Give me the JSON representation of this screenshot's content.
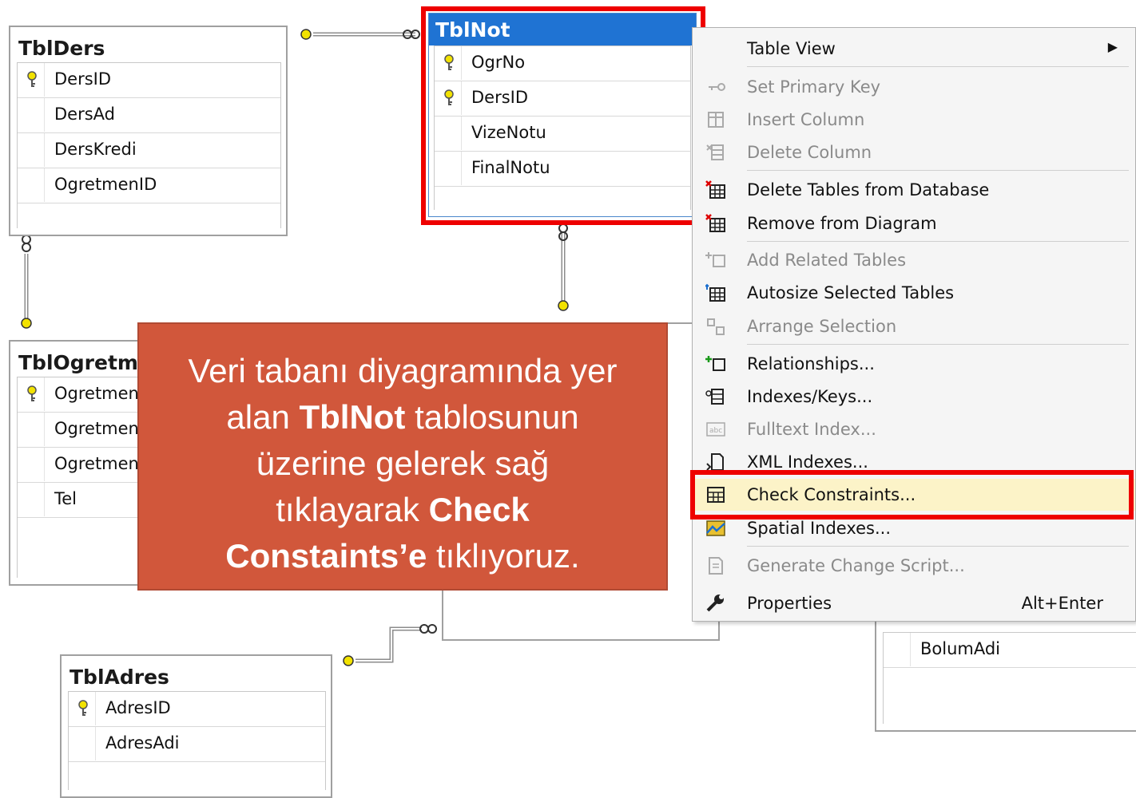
{
  "tables": {
    "tblders": {
      "title": "TblDers",
      "columns": [
        {
          "name": "DersID",
          "key": true
        },
        {
          "name": "DersAd"
        },
        {
          "name": "DersKredi"
        },
        {
          "name": "OgretmenID"
        }
      ]
    },
    "tblnot": {
      "title": "TblNot",
      "columns": [
        {
          "name": "OgrNo",
          "key": true
        },
        {
          "name": "DersID",
          "key": true
        },
        {
          "name": "VizeNotu"
        },
        {
          "name": "FinalNotu"
        }
      ]
    },
    "tblogretmen": {
      "title": "TblOgretmen",
      "columns": [
        {
          "name": "OgretmenID",
          "key": true
        },
        {
          "name": "OgretmenAd"
        },
        {
          "name": "OgretmenSoyad"
        },
        {
          "name": "Tel"
        }
      ]
    },
    "tbladres": {
      "title": "TblAdres",
      "columns": [
        {
          "name": "AdresID",
          "key": true
        },
        {
          "name": "AdresAdi"
        }
      ]
    },
    "tblbolum": {
      "columns": [
        {
          "name": "BolumAdi"
        }
      ]
    }
  },
  "context_menu": {
    "items": [
      {
        "label": "Table View",
        "enabled": true,
        "submenu": true,
        "icon": "none"
      },
      {
        "label": "Set Primary Key",
        "enabled": false,
        "icon": "key-icon"
      },
      {
        "label": "Insert Column",
        "enabled": false,
        "icon": "insert-column-icon"
      },
      {
        "label": "Delete Column",
        "enabled": false,
        "icon": "delete-column-icon"
      },
      {
        "label": "Delete Tables from Database",
        "enabled": true,
        "icon": "delete-table-icon"
      },
      {
        "label": "Remove from Diagram",
        "enabled": true,
        "icon": "remove-table-icon"
      },
      {
        "label": "Add Related Tables",
        "enabled": false,
        "icon": "add-related-icon"
      },
      {
        "label": "Autosize Selected Tables",
        "enabled": true,
        "icon": "autosize-icon"
      },
      {
        "label": "Arrange Selection",
        "enabled": false,
        "icon": "arrange-icon"
      },
      {
        "label": "Relationships...",
        "enabled": true,
        "icon": "relationships-icon"
      },
      {
        "label": "Indexes/Keys...",
        "enabled": true,
        "icon": "indexes-icon"
      },
      {
        "label": "Fulltext Index...",
        "enabled": false,
        "icon": "fulltext-icon"
      },
      {
        "label": "XML Indexes...",
        "enabled": true,
        "icon": "xml-icon"
      },
      {
        "label": "Check Constraints...",
        "enabled": true,
        "highlighted": true,
        "icon": "check-constraints-icon"
      },
      {
        "label": "Spatial Indexes...",
        "enabled": true,
        "icon": "spatial-icon"
      },
      {
        "label": "Generate Change Script...",
        "enabled": false,
        "icon": "script-icon"
      },
      {
        "label": "Properties",
        "enabled": true,
        "shortcut": "Alt+Enter",
        "icon": "wrench-icon"
      }
    ]
  },
  "callout": {
    "line1": "Veri tabanı diyagramında yer",
    "line2a": "alan ",
    "line2b": "TblNot",
    "line2c": " tablosunun",
    "line3": "üzerine gelerek sağ",
    "line4a": "tıklayarak ",
    "line4b": "Check",
    "line5a": "Constaints’e",
    "line5b": " tıklıyoruz."
  },
  "colors": {
    "highlight_border": "#ee0000",
    "callout_bg": "#d1573b",
    "selected_title": "#1f73d3",
    "menu_hot": "#fcf3c8"
  }
}
